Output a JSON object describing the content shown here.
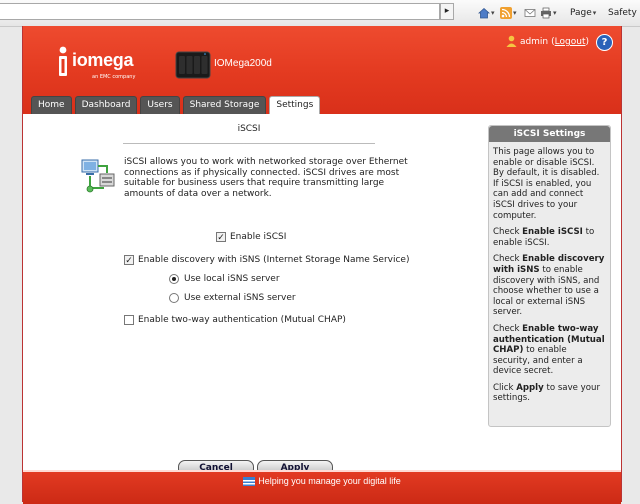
{
  "browser": {
    "search_placeholder": "",
    "search_go": "▸",
    "toolbar": {
      "page_label": "Page",
      "safety_label": "Safety"
    }
  },
  "header": {
    "logo_text": "iomega",
    "logo_sub": "an EMC company",
    "device_name": "IOMega200d",
    "user": {
      "name": "admin",
      "logout_label": "Logout"
    },
    "help_label": "?"
  },
  "tabs": [
    {
      "label": "Home",
      "active": false
    },
    {
      "label": "Dashboard",
      "active": false
    },
    {
      "label": "Users",
      "active": false
    },
    {
      "label": "Shared Storage",
      "active": false
    },
    {
      "label": "Settings",
      "active": true
    }
  ],
  "main": {
    "title": "iSCSI",
    "description": "iSCSI allows you to work with networked storage over Ethernet connections as if physically connected. iSCSI drives are most suitable for business users that require transmitting large amounts of data over a network.",
    "enable_iscsi": {
      "label": "Enable iSCSI",
      "checked": true
    },
    "enable_isns": {
      "label": "Enable discovery with iSNS (Internet Storage Name Service)",
      "checked": true
    },
    "isns_local": {
      "label": "Use local iSNS server",
      "selected": true
    },
    "isns_external": {
      "label": "Use external iSNS server",
      "selected": false
    },
    "mutual_chap": {
      "label": "Enable two-way authentication (Mutual CHAP)",
      "checked": false
    },
    "cancel_label": "Cancel",
    "apply_label": "Apply"
  },
  "side_panel": {
    "title": "iSCSI Settings",
    "p1": "This page allows you to enable or disable iSCSI. By default, it is disabled. If iSCSI is enabled, you can add and connect iSCSI drives to your computer.",
    "p2_pre": "Check ",
    "p2_bold": "Enable iSCSI",
    "p2_post": " to enable iSCSI.",
    "p3_pre": "Check ",
    "p3_bold": "Enable discovery with iSNS",
    "p3_post": " to enable discovery with iSNS, and choose whether to use a local or external iSNS server.",
    "p4_pre": "Check ",
    "p4_bold": "Enable two-way authentication (Mutual CHAP)",
    "p4_post": " to enable security, and enter a device secret.",
    "p5_pre": "Click ",
    "p5_bold": "Apply",
    "p5_post": " to save your settings."
  },
  "footer": {
    "tagline": "Helping you manage your digital life"
  },
  "colors": {
    "brand_red": "#e33a20",
    "tab_dark": "#555555",
    "side_header": "#777777"
  }
}
